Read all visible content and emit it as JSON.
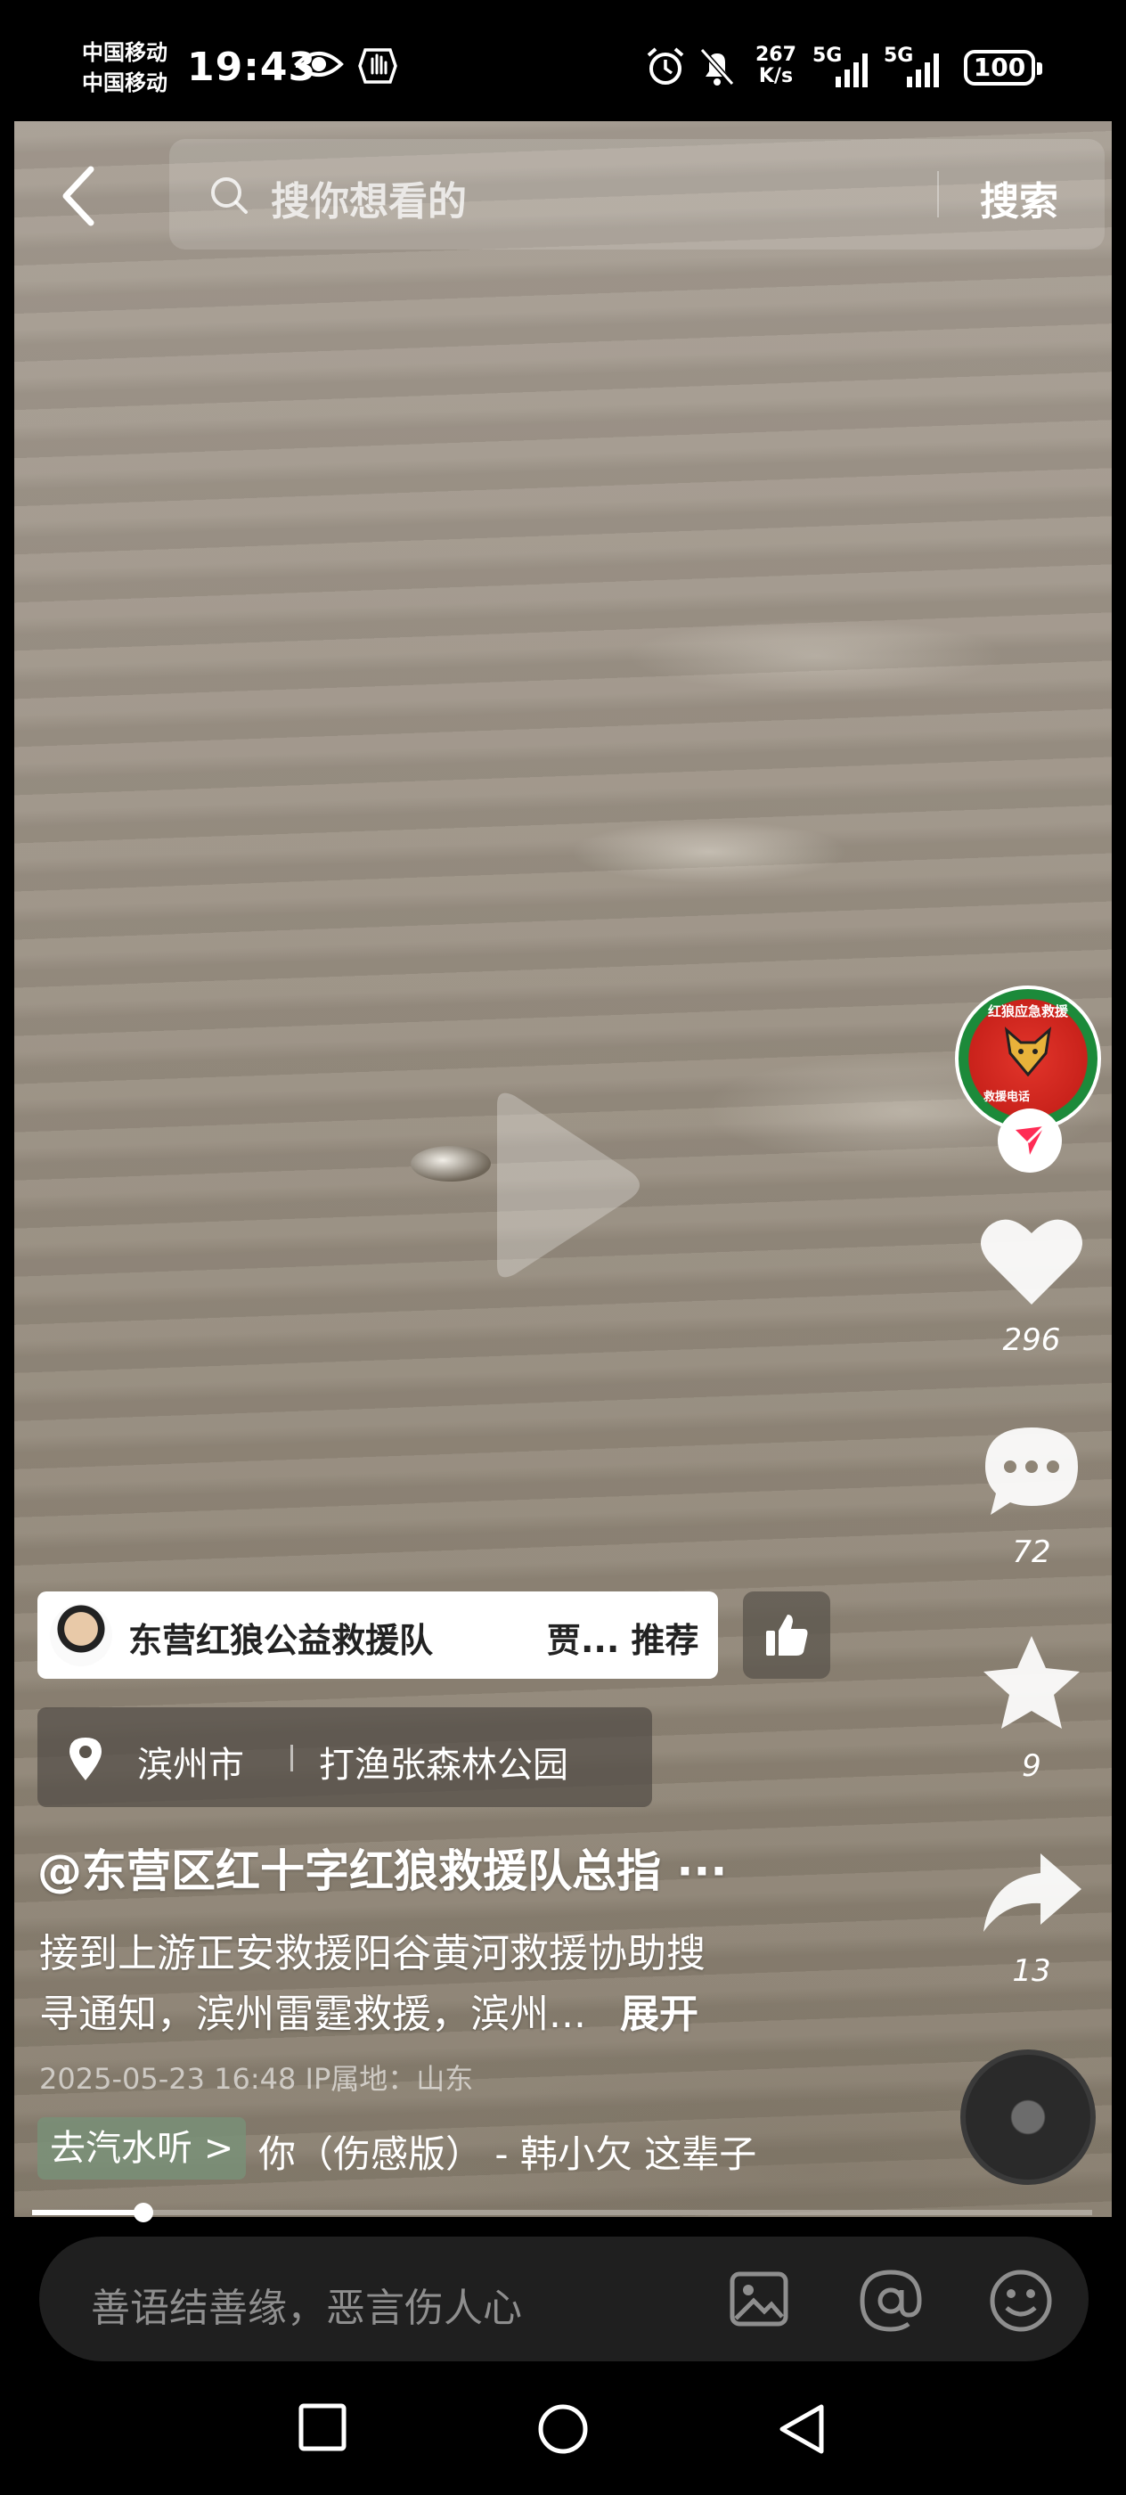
{
  "status_bar": {
    "carrier_1": "中国移动",
    "carrier_2": "中国移动",
    "time": "19:43",
    "net_speed_value": "267",
    "net_speed_unit": "K/s",
    "signal_1_label": "5G",
    "signal_2_label": "5G",
    "battery": "100",
    "icons": [
      "eye-icon",
      "hand-icon",
      "alarm-icon",
      "mute-bell-icon",
      "signal-icon",
      "battery-icon"
    ]
  },
  "search": {
    "placeholder": "搜你想看的",
    "button_label": "搜索"
  },
  "rail": {
    "avatar_text_top": "红狼应急救援",
    "avatar_text_bottom": "救援电话",
    "likes": "296",
    "comments": "72",
    "favorites": "9",
    "shares": "13"
  },
  "account": {
    "name": "东营红狼公益救援队",
    "recommender": "贾... 推荐"
  },
  "location": {
    "city": "滨州市",
    "place": "打渔张森林公园"
  },
  "post": {
    "title": "@东营区红十字红狼救援队总指 ···",
    "desc_line_1": "接到上游正安救援阳谷黄河救援协助搜",
    "desc_line_2": "寻通知，滨州雷霆救援，滨州...",
    "expand_label": "展开",
    "meta": "2025-05-23 16:48  IP属地：山东"
  },
  "music": {
    "chip_label": "去汽水听 >",
    "title": "你（伤感版） - 韩小欠    这辈子"
  },
  "progress": {
    "fraction": 0.105
  },
  "comment_bar": {
    "placeholder": "善语结善缘，恶言伤人心"
  },
  "colors": {
    "water": "#9a9083",
    "follow_red": "#ff2c55",
    "comment_bar_bg": "#1f1f1f"
  }
}
